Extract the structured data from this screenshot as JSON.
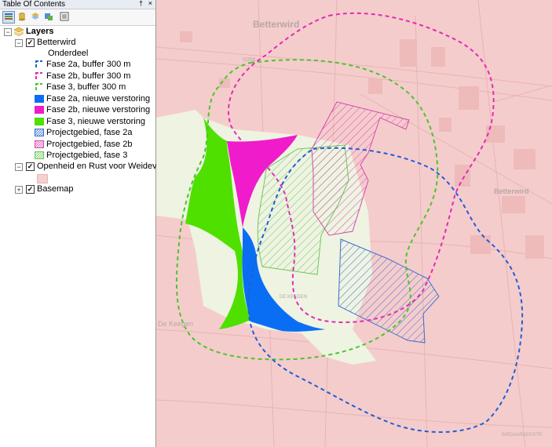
{
  "toc": {
    "title": "Table Of Contents",
    "pin_glyph": "†",
    "close_glyph": "×",
    "tools": [
      "list-by-drawing-order-icon",
      "list-by-source-icon",
      "list-by-visibility-icon",
      "list-by-selection-icon",
      "options-icon"
    ],
    "layers_label": "Layers",
    "groups": [
      {
        "name": "Betterwird",
        "checked": true,
        "expanded": true,
        "field_label": "Onderdeel",
        "items": [
          {
            "label": "Fase 2a, buffer 300 m",
            "kind": "dashed",
            "color": "#1f5fd6"
          },
          {
            "label": "Fase 2b, buffer 300 m",
            "kind": "dashed",
            "color": "#e22bb5"
          },
          {
            "label": "Fase 3, buffer 300 m",
            "kind": "dashed",
            "color": "#49c62b"
          },
          {
            "label": "Fase 2a, nieuwe verstoring",
            "kind": "fill",
            "color": "#0a6ef5"
          },
          {
            "label": "Fase 2b, nieuwe verstoring",
            "kind": "fill",
            "color": "#f01bcb"
          },
          {
            "label": "Fase 3, nieuwe verstoring",
            "kind": "fill",
            "color": "#4fe000"
          },
          {
            "label": "Projectgebied, fase 2a",
            "kind": "hatch",
            "color": "#3c6fd0"
          },
          {
            "label": "Projectgebied, fase 2b",
            "kind": "hatch",
            "color": "#d64ab0"
          },
          {
            "label": "Projectgebied, fase 3",
            "kind": "hatch",
            "color": "#6fc85a"
          }
        ]
      },
      {
        "name": "Openheid en Rust voor Weidevogels",
        "checked": true,
        "expanded": true,
        "swatch_color": "#f6cfcf"
      },
      {
        "name": "Basemap",
        "checked": true,
        "expanded": false
      }
    ]
  },
  "map": {
    "background_color": "#f5cccc",
    "openheid_area_color": "#eef3e2",
    "labels": {
      "town_top": "Betterwird",
      "town_right": "Betterwird",
      "road_n": "N356",
      "road_de_keegen": "DE KEEGEN",
      "area_de_keegen": "De Keegen",
      "road_bottom_right": "BIRDAARDERSTR"
    }
  }
}
